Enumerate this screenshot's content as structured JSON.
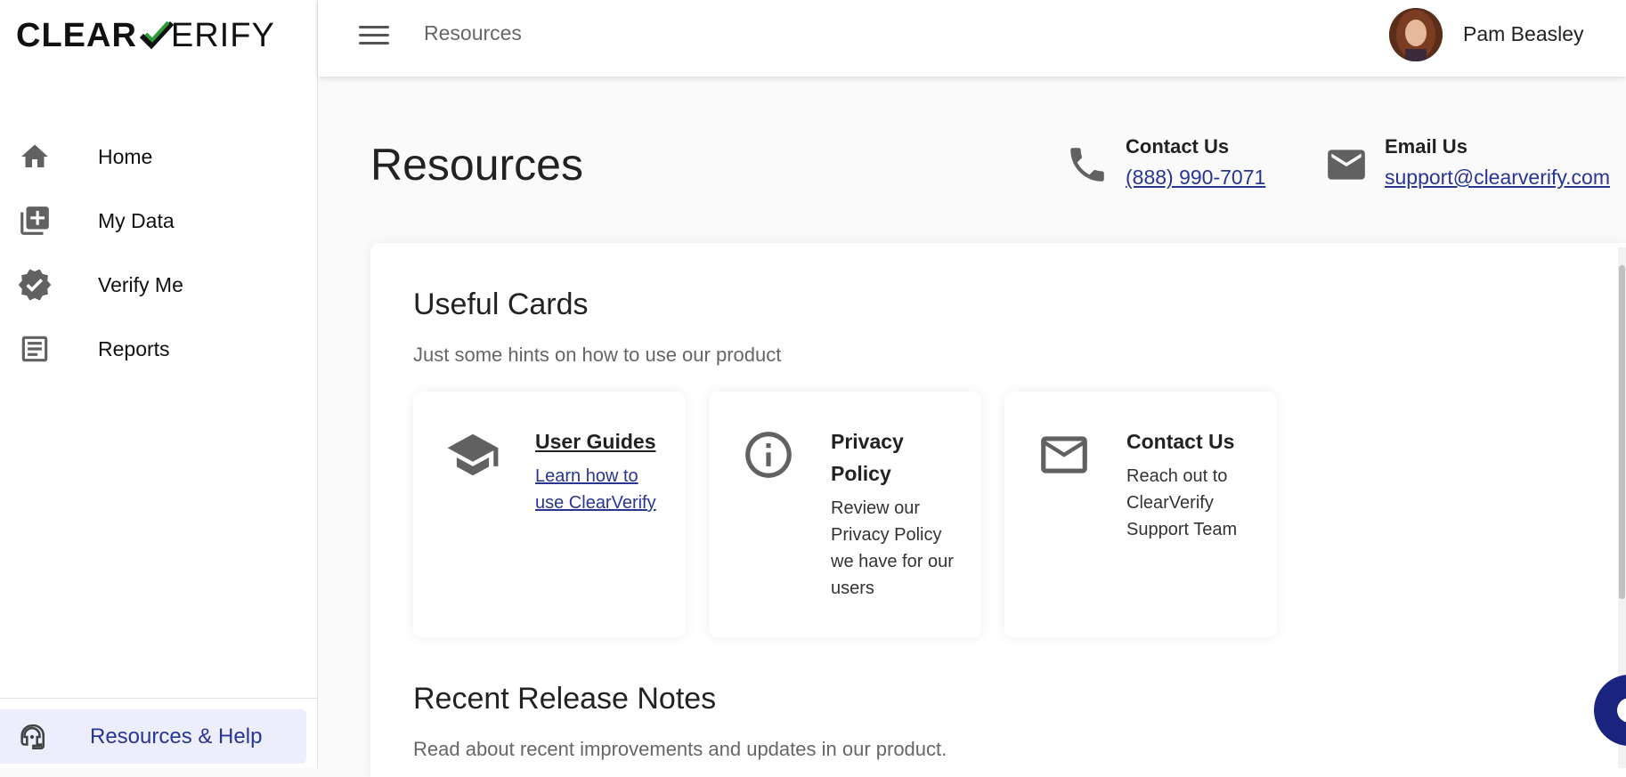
{
  "brand": {
    "name_left": "CLEAR",
    "name_right": "ERIFY",
    "accent": "#2e9d3a"
  },
  "sidebar": {
    "items": [
      {
        "label": "Home",
        "icon": "home-icon"
      },
      {
        "label": "My Data",
        "icon": "my-data-icon"
      },
      {
        "label": "Verify Me",
        "icon": "verified-badge-icon"
      },
      {
        "label": "Reports",
        "icon": "reports-icon"
      }
    ],
    "help": {
      "label": "Resources & Help",
      "icon": "support-agent-icon"
    }
  },
  "header": {
    "breadcrumb": "Resources",
    "user_name": "Pam Beasley",
    "menu_icon": "hamburger-menu-icon"
  },
  "page": {
    "title": "Resources",
    "contact_phone": {
      "title": "Contact Us",
      "value": "(888) 990-7071",
      "icon": "phone-icon"
    },
    "contact_email": {
      "title": "Email Us",
      "value": "support@clearverify.com",
      "icon": "mail-icon"
    }
  },
  "useful_cards": {
    "title": "Useful Cards",
    "subtitle": "Just some hints on how to use our product",
    "cards": [
      {
        "title": "User Guides",
        "desc": "Learn how to use ClearVerify",
        "icon": "graduation-cap-icon"
      },
      {
        "title": "Privacy Policy",
        "desc": "Review our Privacy Policy we have for our users",
        "icon": "info-icon"
      },
      {
        "title": "Contact Us",
        "desc": "Reach out to ClearVerify Support Team",
        "icon": "mail-outline-icon"
      }
    ]
  },
  "release_notes": {
    "title": "Recent Release Notes",
    "subtitle": "Read about recent improvements and updates in our product."
  },
  "colors": {
    "link": "#283593",
    "help_bg": "#eceefb",
    "icon_grey": "#616161"
  }
}
